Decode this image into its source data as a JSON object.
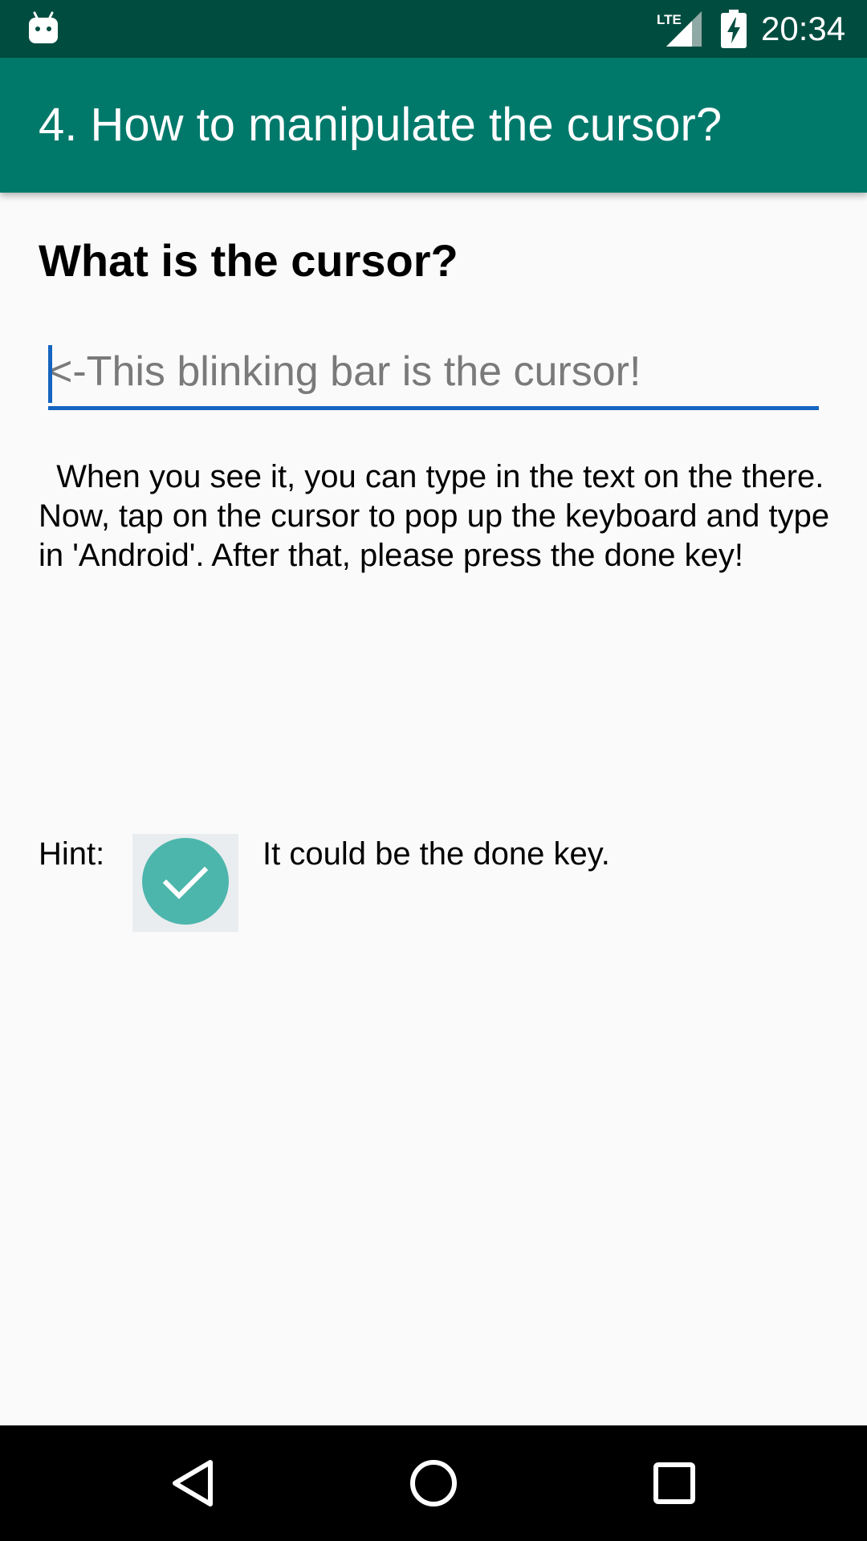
{
  "status_bar": {
    "time": "20:34",
    "icons": [
      "android-debug-icon",
      "lte-signal-icon",
      "battery-charging-icon"
    ]
  },
  "app_bar": {
    "title": "4. How to manipulate the cursor?"
  },
  "content": {
    "heading": "What is the cursor?",
    "input": {
      "placeholder": "<-This blinking bar is the cursor!",
      "value": ""
    },
    "instructions": "  When you see it, you can type in the text on the there. Now, tap on the cursor to pop up the keyboard and type in 'Android'. After that, please press the done key!",
    "hint": {
      "label": "Hint:",
      "icon": "done-check-icon",
      "text": "It could be the done key."
    }
  },
  "nav_bar": {
    "buttons": [
      "back-icon",
      "home-icon",
      "recents-icon"
    ]
  },
  "colors": {
    "status_bar": "#004d40",
    "app_bar": "#00796b",
    "accent": "#1565c0",
    "check_circle": "#4db6ac",
    "background": "#fafafa"
  }
}
